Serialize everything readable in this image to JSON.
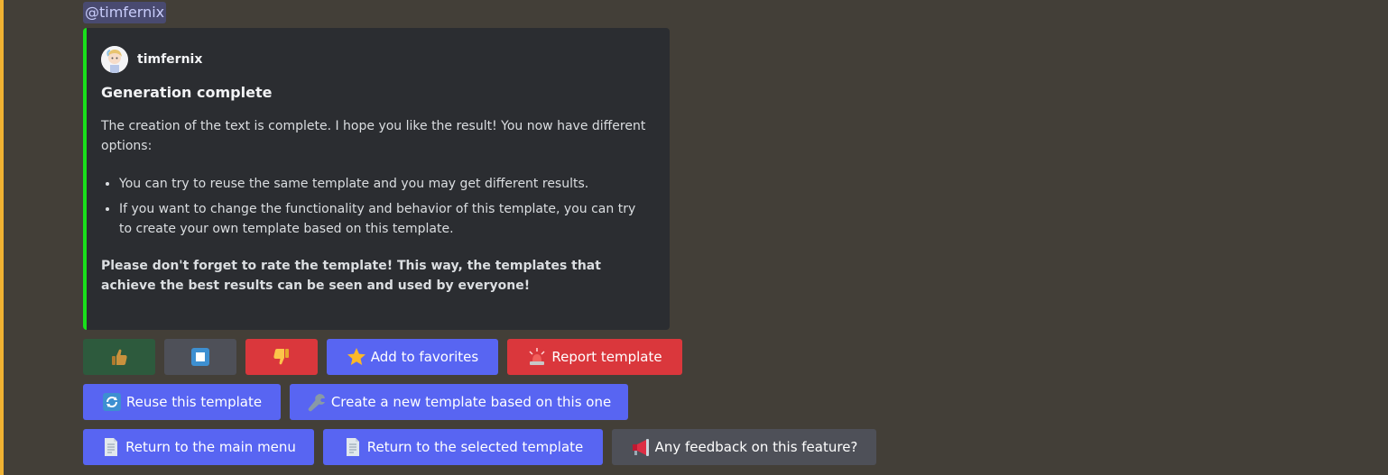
{
  "message": {
    "mention": "@timfernix",
    "highlight_color": "#f0b232"
  },
  "embed": {
    "accent_color": "#19e01b",
    "author": {
      "name": "timfernix",
      "avatar_icon": "avatar-image"
    },
    "title": "Generation complete",
    "intro": "The creation of the text is complete. I hope you like the result! You now have different options:",
    "bullets": [
      "You can try to reuse the same template and you may get different results.",
      "If you want to change the functionality and behavior of this template, you can try to create your own template based on this template."
    ],
    "closing": "Please don't forget to rate the template! This way, the templates that achieve the best results can be seen and used by everyone!"
  },
  "buttons": {
    "row1": {
      "like": {
        "icon": "thumbs-up-icon",
        "style": "success"
      },
      "stop": {
        "icon": "stop-icon",
        "style": "secondary"
      },
      "dislike": {
        "icon": "thumbs-down-icon",
        "style": "danger"
      },
      "favorite": {
        "icon": "star-icon",
        "label": "Add to favorites",
        "style": "primary"
      },
      "report": {
        "icon": "rotating-light-icon",
        "label": "Report template",
        "style": "danger"
      }
    },
    "row2": {
      "reuse": {
        "icon": "arrows-refresh-icon",
        "label": "Reuse this template",
        "style": "primary"
      },
      "create_new": {
        "icon": "wrench-icon",
        "label": "Create a new template based on this one",
        "style": "primary"
      }
    },
    "row3": {
      "main_menu": {
        "icon": "document-icon",
        "label": "Return to the main menu",
        "style": "primary"
      },
      "selected_template": {
        "icon": "document-icon",
        "label": "Return to the selected template",
        "style": "primary"
      },
      "feedback": {
        "icon": "megaphone-icon",
        "label": "Any feedback on this feature?",
        "style": "secondary"
      }
    }
  }
}
